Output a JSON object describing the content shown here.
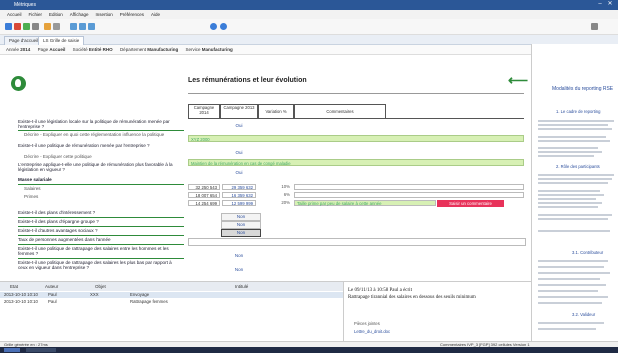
{
  "window": {
    "title": "Métriques"
  },
  "menu": [
    "Accueil",
    "Fichier",
    "Edition",
    "Affichage",
    "Insertion",
    "Préférences",
    "Aide"
  ],
  "tabs": [
    "Page d'accueil",
    "LS Grille de saisie"
  ],
  "filters": {
    "annee_label": "Année",
    "annee": "2014",
    "page_label": "Page",
    "page": "Accueil",
    "societe_label": "Société",
    "societe": "Entité RHO",
    "departement_label": "Département",
    "departement": "Manufacturing",
    "service_label": "Service",
    "service": "Manufacturing"
  },
  "page": {
    "title": "Les rémunérations et leur évolution"
  },
  "questions": [
    "Existe-t-il une législation locale sur la politique de rémunération menée par l'entreprise ?",
    "Décrire - Expliquer en quoi cette réglementation influence la politique",
    "Existe-t-il une politique de rémunération menée par l'entreprise ?",
    "Décrire - Expliquer cette politique",
    "L'entreprise applique-t-elle une politique de rémunération plus favorable à la législation en vigueur ?",
    "Masse salariale",
    "Salaires",
    "Primes",
    "Existe-t-il des plans d'intéressement ?",
    "Existe-t-il des plans d'épargne groupe ?",
    "Existe-t-il d'autres avantages sociaux ?",
    "Taux de personnes augmentées dans l'année",
    "Existe-t-il une politique de rattrapage des salaires entre les hommes et les femmes ?",
    "Existe-t-il une politique de rattrapage des salaires les plus bas par rapport à ceux en vigueur dans l'entreprise ?"
  ],
  "table": {
    "headers": [
      "Campagne 2014",
      "Campagne 2013",
      "Variation %",
      "Commentaires"
    ],
    "oui": "Oui",
    "non": "Non",
    "green1": "XYZ 2000",
    "green2": "Maintien de la rémunération en cas de congé maladie",
    "rows": [
      {
        "a": "32 250 543",
        "b": "29 359 632",
        "v": "10%",
        "c": ""
      },
      {
        "a": "18 007 654",
        "b": "16 359 632",
        "v": "6%",
        "c": ""
      },
      {
        "a": "14 254 699",
        "b": "12 599 999",
        "v": "20%",
        "c": "Taille prime par peu de salaire à cette année"
      }
    ],
    "comment_button": "Saisir un commentaire"
  },
  "bottom": {
    "headers": [
      "Etat",
      "Auteur",
      "Objet",
      "Intitulé"
    ],
    "rows": [
      {
        "date": "2013-10-10 10:10",
        "author": "Paul",
        "obj": "XXX",
        "label": "Envoyage"
      },
      {
        "date": "2013-10-10 10:10",
        "author": "Paul",
        "obj": "",
        "label": "Rattrapage femmes"
      }
    ]
  },
  "notes": {
    "meta": "Le 09/11/13 à 10:58 Paul a écrit",
    "text": "Rattrapage tirannial des salaires en dessous des seuils minimum",
    "attach_label": "Pièces jointes",
    "attach": "Lettre_du_droit.doc"
  },
  "rightpanel": {
    "title": "Modalités du reporting RSE",
    "section1": "1. Le cadre de reporting",
    "section2": "2. Rôle des participants",
    "section3": "3.1. Contributeur",
    "section4": "3.2. Valideur"
  },
  "status": {
    "left": "Grille générée en : 27ms",
    "right": "Commentaires   IVP_3   [FGP]   392 cellules   Version 1"
  }
}
